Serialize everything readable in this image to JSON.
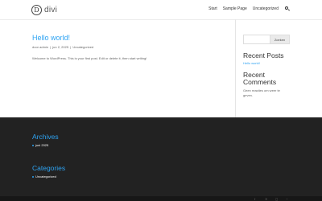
{
  "header": {
    "logo_mark": "D",
    "logo_text": "divi",
    "nav": [
      "Start",
      "Sample Page",
      "Uncategorized"
    ]
  },
  "post": {
    "title": "Hello world!",
    "meta_author": "door admin",
    "meta_date": "jun 2, 2025",
    "meta_category": "Uncategorized",
    "body": "Welcome to WordPress. This is your first post. Edit or delete it, then start writing!"
  },
  "sidebar": {
    "search_button": "Zoeken",
    "recent_posts_title": "Recent Posts",
    "recent_posts_items": [
      "Hello world!"
    ],
    "recent_comments_title": "Recent Comments",
    "recent_comments_empty": "Geen reacties om weer te geven."
  },
  "footer": {
    "archives_title": "Archives",
    "archives_items": [
      "juni 2025"
    ],
    "categories_title": "Categories",
    "categories_items": [
      "Uncategorized"
    ]
  },
  "social_icons": [
    "facebook-icon",
    "x-icon",
    "instagram-icon",
    "rss-icon"
  ],
  "colors": {
    "accent": "#2ea3f2",
    "footer_bg": "#222222",
    "bottom_bar_bg": "#171717"
  }
}
